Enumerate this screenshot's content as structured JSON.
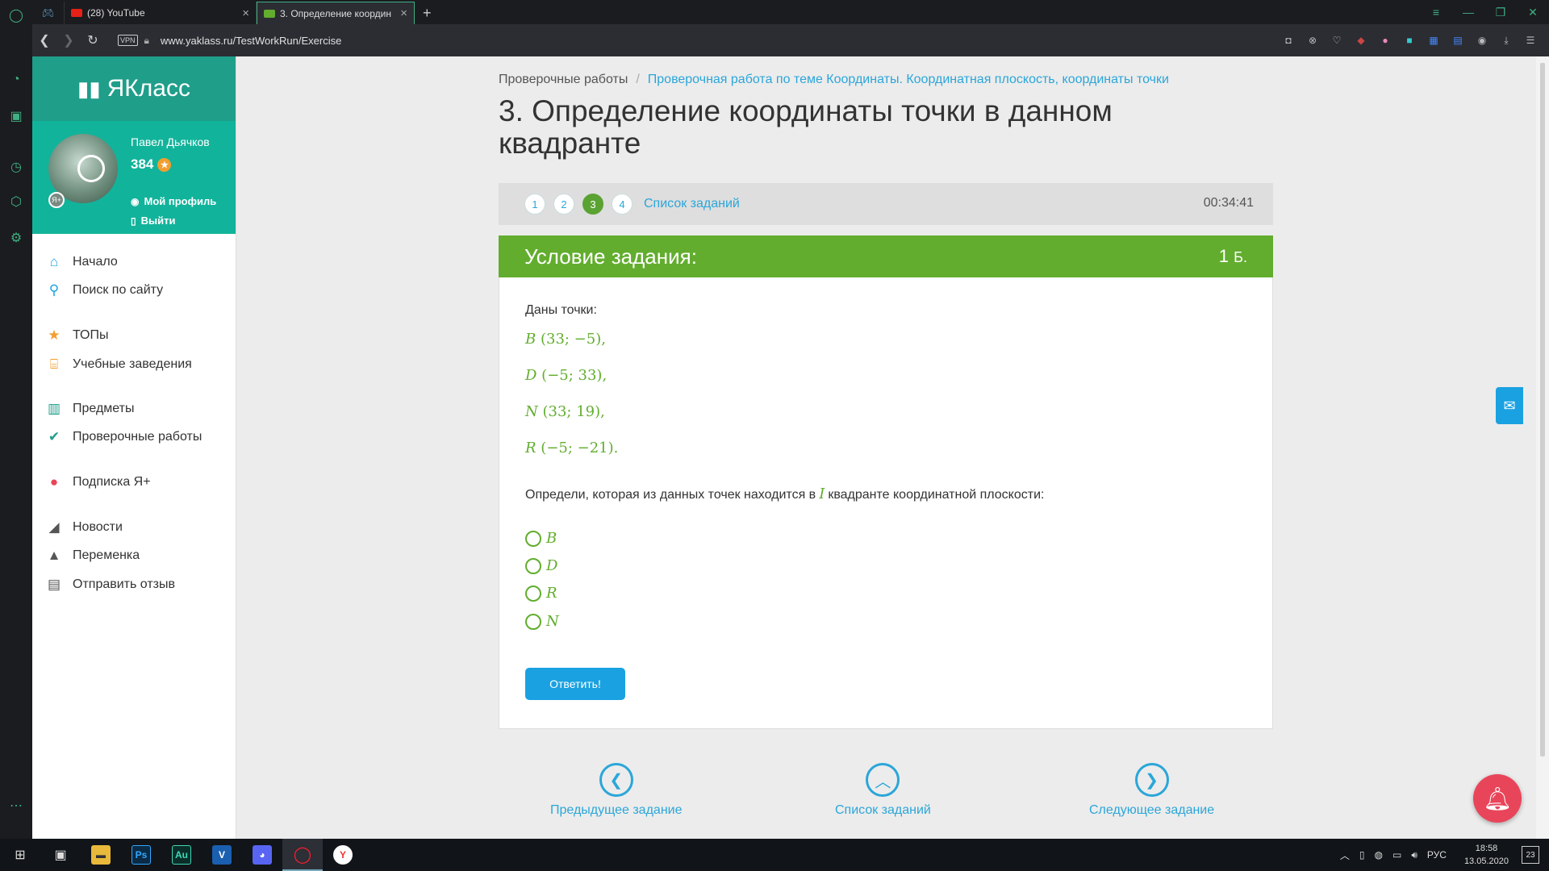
{
  "browser": {
    "tabs": [
      {
        "label": "(28) YouTube",
        "favicon_color": "#e62117"
      },
      {
        "label": "3. Определение координ",
        "favicon_color": "#62ad2e"
      }
    ],
    "new_tab": "+",
    "vpn_label": "VPN",
    "url": "www.yaklass.ru/TestWorkRun/Exercise"
  },
  "site": {
    "brand": "ЯКласс",
    "profile": {
      "name": "Павел Дьячков",
      "score": "384",
      "profile_link": "Мой профиль",
      "logout_link": "Выйти"
    },
    "menu": [
      {
        "label": "Начало",
        "icon": "home-icon"
      },
      {
        "label": "Поиск по сайту",
        "icon": "search-icon"
      },
      {
        "label": "ТОПы",
        "icon": "star-icon"
      },
      {
        "label": "Учебные заведения",
        "icon": "institution-icon"
      },
      {
        "label": "Предметы",
        "icon": "books-icon"
      },
      {
        "label": "Проверочные работы",
        "icon": "check-circle-icon"
      },
      {
        "label": "Подписка Я+",
        "icon": "subscription-icon"
      },
      {
        "label": "Новости",
        "icon": "megaphone-icon"
      },
      {
        "label": "Переменка",
        "icon": "bell-icon"
      },
      {
        "label": "Отправить отзыв",
        "icon": "feedback-icon"
      }
    ]
  },
  "breadcrumb": {
    "root": "Проверочные работы",
    "separator": "/",
    "current": "Проверочная работа по теме Координаты. Координатная плоскость, координаты точки"
  },
  "page_title": "3. Определение координаты точки в данном квадранте",
  "task_nav": {
    "numbers": [
      "1",
      "2",
      "3",
      "4"
    ],
    "current": "3",
    "list_link": "Список заданий",
    "timer": "00:34:41"
  },
  "condition": {
    "header": "Условие задания:",
    "points_value": "1",
    "points_unit": "Б.",
    "intro": "Даны точки:",
    "points": [
      {
        "name": "B",
        "coords": "(33; −5),"
      },
      {
        "name": "D",
        "coords": "(−5; 33),"
      },
      {
        "name": "N",
        "coords": "(33; 19),"
      },
      {
        "name": "R",
        "coords": "(−5; −21)."
      }
    ],
    "question_before": "Определи, которая из данных точек находится в",
    "question_quadrant": "I",
    "question_after": "квадранте координатной плоскости:",
    "options": [
      "B",
      "D",
      "R",
      "N"
    ],
    "submit_label": "Ответить!"
  },
  "bottom_nav": {
    "prev": "Предыдущее задание",
    "list": "Список заданий",
    "next": "Следующее задание"
  },
  "taskbar": {
    "apps": [
      "Ps",
      "Au",
      "V"
    ],
    "lang": "РУС",
    "time": "18:58",
    "date": "13.05.2020",
    "notifications": "23"
  },
  "colors": {
    "accent_green": "#62ad2e",
    "brand_teal": "#1f9e8a",
    "link_blue": "#2ba6d9",
    "button_blue": "#1aa1e1"
  }
}
